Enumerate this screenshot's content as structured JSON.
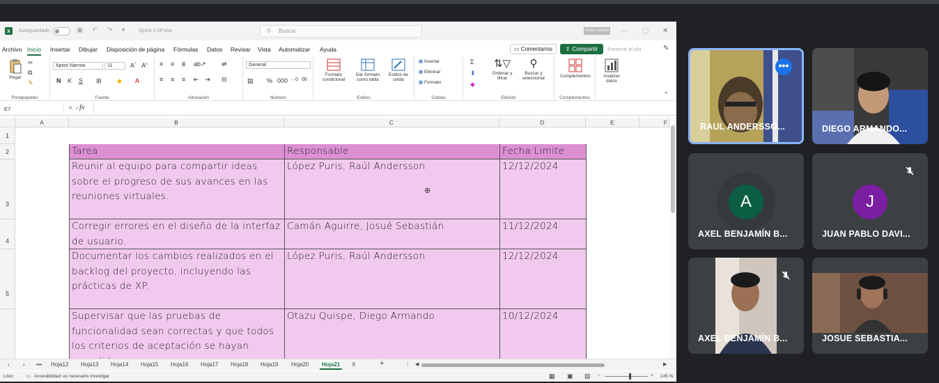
{
  "excel": {
    "autosave_label": "Autoguardado",
    "doc_title": "Sprint 3 XP.xlsx",
    "search_placeholder": "Buscar",
    "signin_label": "Iniciar sesión",
    "menu_tabs": [
      "Archivo",
      "Inicio",
      "Insertar",
      "Dibujar",
      "Disposición de página",
      "Fórmulas",
      "Datos",
      "Revisar",
      "Vista",
      "Automatizar",
      "Ayuda"
    ],
    "active_tab": "Inicio",
    "comments_label": "Comentarios",
    "share_label": "Compartir",
    "ontheday_label": "Ponerse al día",
    "ribbon": {
      "paste": "Pegar",
      "clipboard": "Portapapeles",
      "font_name": "Aptos Narrow",
      "font_size": "11",
      "font_group": "Fuente",
      "alignment_group": "Alineación",
      "number_format": "General",
      "number_group": "Número",
      "cond_format": "Formato condicional",
      "table_format": "Dar formato como tabla",
      "cell_styles": "Estilos de celda",
      "styles_group": "Estilos",
      "insert": "Insertar",
      "delete": "Eliminar",
      "format": "Formato",
      "cells_group": "Celdas",
      "sort_filter": "Ordenar y filtrar",
      "find_select": "Buscar y seleccionar",
      "editing_group": "Edición",
      "addins": "Complementos",
      "addins_group": "Complementos",
      "analyze": "Analizar datos"
    },
    "name_box": "E7",
    "fx_label": "fx",
    "columns": [
      "A",
      "B",
      "C",
      "D",
      "E",
      "F"
    ],
    "rows": [
      "1",
      "2",
      "3",
      "4",
      "5"
    ],
    "table": {
      "headers": [
        "Tarea",
        "Responsable",
        "Fecha Limite"
      ],
      "rows": [
        [
          "Reunir al equipo para compartir ideas sobre el progreso de sus avances en las reuniones virtuales.",
          "López Puris, Raúl Andersson",
          "12/12/2024"
        ],
        [
          "Corregir errores en el diseño de la interfaz de usuario.",
          "Camán Aguirre, Josué Sebastián",
          "11/12/2024"
        ],
        [
          "Documentar los cambios realizados en el backlog del proyecto, incluyendo las prácticas de XP.",
          "López Puris, Raúl Andersson",
          "12/12/2024"
        ],
        [
          "Supervisar que las pruebas de funcionalidad sean correctas y que todos los criterios de aceptación se hayan cumplido",
          "Otazu Quispe, Diego Armando",
          "10/12/2024"
        ]
      ]
    },
    "sheet_tabs": [
      "Hoja12",
      "Hoja13",
      "Hoja14",
      "Hoja15",
      "Hoja16",
      "Hoja17",
      "Hoja18",
      "Hoja19",
      "Hoja20",
      "Hoja21",
      "X"
    ],
    "active_sheet": "Hoja21",
    "status_ready": "Listo",
    "accessibility": "Accesibilidad: es necesario investigar",
    "zoom": "145 %"
  },
  "meet": {
    "participants": [
      {
        "name": "RAUL ANDERSSO...",
        "type": "video",
        "active": true,
        "muted": false
      },
      {
        "name": "DIEGO ARMANDO...",
        "type": "video",
        "active": false,
        "muted": false
      },
      {
        "name": "AXEL BENJAMÍN B...",
        "type": "avatar",
        "initial": "A",
        "color": "#0b5e44",
        "muted": false
      },
      {
        "name": "JUAN PABLO DAVI...",
        "type": "avatar",
        "initial": "J",
        "color": "#7b1fa2",
        "muted": true
      },
      {
        "name": "AXEL BENJAMÍN B...",
        "type": "video",
        "muted": true
      },
      {
        "name": "JOSUE SEBASTIA...",
        "type": "video",
        "muted": false
      }
    ]
  },
  "colors": {
    "header_fill": "#dd8fd4",
    "cell_fill": "#f2c9ee",
    "excel_green": "#1d6f42",
    "meet_bg": "#202124",
    "active_border": "#8ab4f8"
  }
}
